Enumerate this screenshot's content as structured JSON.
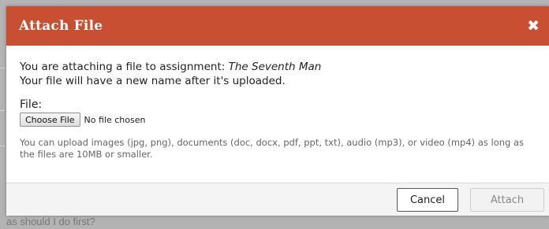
{
  "background": {
    "partial_text": "as should I do first?"
  },
  "dialog": {
    "title": "Attach File",
    "close_symbol": "✖",
    "intro_prefix": "You are attaching a file to assignment: ",
    "assignment_name": "The Seventh Man",
    "rename_notice": "Your file will have a new name after it's uploaded.",
    "file_label": "File:",
    "choose_button_label": "Choose File",
    "no_file_text": "No file chosen",
    "help_text": "You can upload images (jpg, png), documents (doc, docx, pdf, ppt, txt), audio (mp3), or video (mp4) as long as the files are 10MB or smaller.",
    "cancel_label": "Cancel",
    "attach_label": "Attach"
  },
  "colors": {
    "header": "#c94f32",
    "header_text": "#ffffff",
    "attach_disabled_text": "#8a8a8a"
  },
  "icons": {
    "close": "close-icon"
  }
}
